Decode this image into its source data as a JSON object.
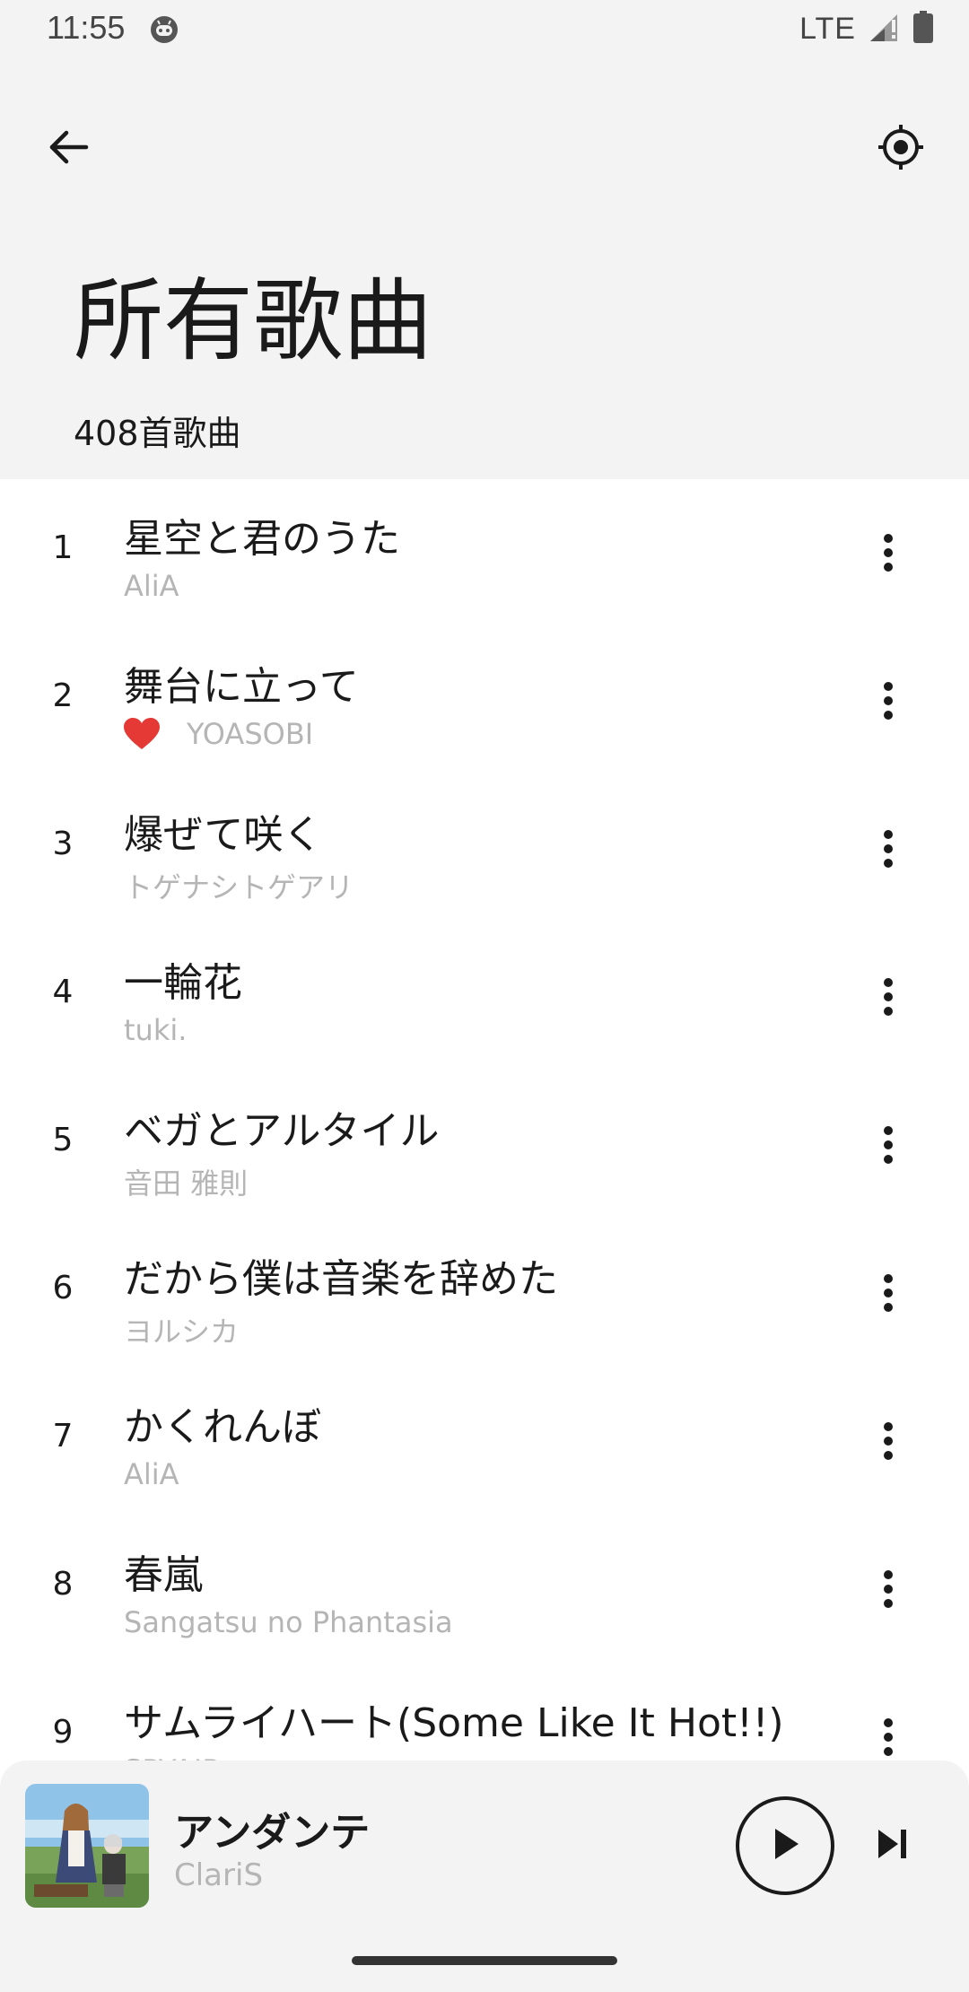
{
  "status_bar": {
    "time": "11:55",
    "network": "LTE",
    "app_icon": "android-robot-icon",
    "signal_icon": "signal-icon",
    "battery_icon": "battery-icon"
  },
  "header": {
    "back_icon": "arrow-left-icon",
    "locate_icon": "crosshair-icon"
  },
  "page": {
    "title": "所有歌曲",
    "count": "408首歌曲"
  },
  "songs": [
    {
      "index": "1",
      "title": "星空と君のうた",
      "artist": "AliA",
      "favorite": false
    },
    {
      "index": "2",
      "title": "舞台に立って",
      "artist": "YOASOBI",
      "favorite": true
    },
    {
      "index": "3",
      "title": "爆ぜて咲く",
      "artist": "トゲナシトゲアリ",
      "favorite": false
    },
    {
      "index": "4",
      "title": "一輪花",
      "artist": "tuki.",
      "favorite": false
    },
    {
      "index": "5",
      "title": "ベガとアルタイル",
      "artist": "音田 雅則",
      "favorite": false
    },
    {
      "index": "6",
      "title": "だから僕は音楽を辞めた",
      "artist": "ヨルシカ",
      "favorite": false
    },
    {
      "index": "7",
      "title": "かくれんぼ",
      "artist": "AliA",
      "favorite": false
    },
    {
      "index": "8",
      "title": "春嵐",
      "artist": "Sangatsu no Phantasia",
      "favorite": false
    },
    {
      "index": "9",
      "title": "サムライハート(Some Like It Hot!!)",
      "artist": "SPYAIR",
      "favorite": false
    }
  ],
  "now_playing": {
    "title": "アンダンテ",
    "artist": "ClariS",
    "play_icon": "play-icon",
    "next_icon": "skip-next-icon"
  },
  "colors": {
    "header_bg": "#f3f3f4",
    "list_bg": "#ffffff",
    "heart": "#e53935",
    "secondary_text": "#b5b5b5"
  }
}
